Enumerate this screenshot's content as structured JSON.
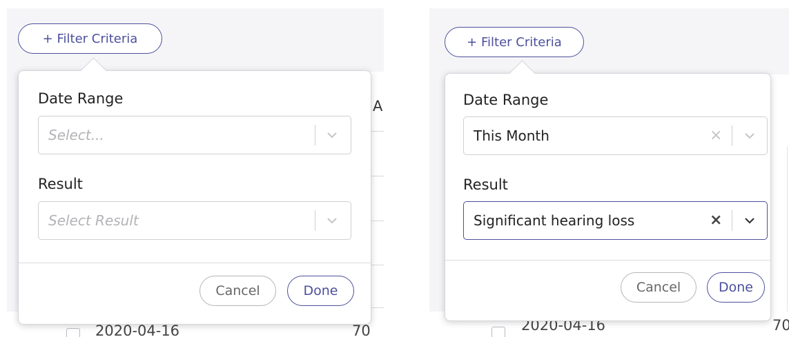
{
  "filter_button_label": "+ Filter Criteria",
  "left": {
    "date_range_label": "Date Range",
    "date_range_placeholder": "Select...",
    "result_label": "Result",
    "result_placeholder": "Select Result",
    "cancel_label": "Cancel",
    "done_label": "Done",
    "bg_header_letter": "A",
    "bg_row_date": "2020-04-16",
    "bg_row_num": "70",
    "bg_cell_fragment": ")"
  },
  "right": {
    "date_range_label": "Date Range",
    "date_range_value": "This Month",
    "result_label": "Result",
    "result_value": "Significant hearing loss",
    "cancel_label": "Cancel",
    "done_label": "Done",
    "bg_row_date": "2020-04-16",
    "bg_row_num": "70"
  },
  "icons": {
    "clear": "×",
    "chevron": "chevron-down-icon"
  },
  "colors": {
    "accent": "#4b4f9c",
    "placeholder": "#b3b3b8",
    "border": "#cfcfd6",
    "panel_bg": "#f5f5f7"
  }
}
